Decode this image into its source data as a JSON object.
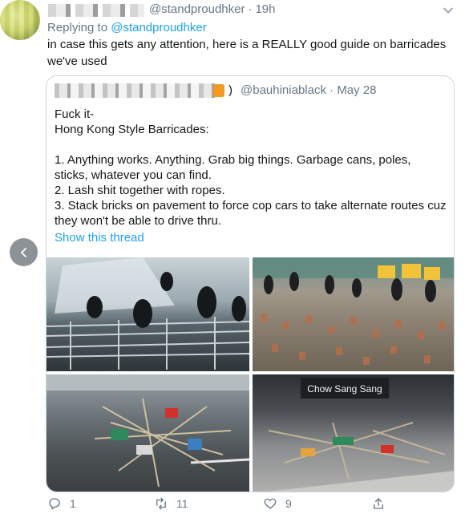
{
  "tweet": {
    "handle": "@standproudhker",
    "separator": "·",
    "time": "19h",
    "reply_prefix": "Replying to ",
    "reply_handle": "@standproudhker",
    "text": "in case this gets any attention, here is a REALLY good guide on barricades we've used"
  },
  "quote": {
    "paren": ")",
    "handle": "@bauhiniablack",
    "separator": "·",
    "date": "May 28",
    "body": "Fuck it-\nHong Kong Style Barricades:\n\n1. Anything works. Anything. Grab big things. Garbage cans, poles, sticks, whatever you can find.\n2. Lash shit together with ropes.\n3. Stack bricks on pavement to force cop cars to take alternate routes cuz they won't be able to drive thru.",
    "show_thread": "Show this thread",
    "shop_sign": "Chow Sang Sang"
  },
  "actions": {
    "reply_count": "1",
    "retweet_count": "11",
    "like_count": "9"
  },
  "icons": {
    "caret": "chevron-down-icon",
    "left_nav": "chevron-left-icon",
    "reply": "reply-icon",
    "retweet": "retweet-icon",
    "like": "heart-icon",
    "share": "share-icon"
  },
  "colors": {
    "link": "#1da1f2",
    "muted": "#657786",
    "border": "#ccd6dd"
  }
}
